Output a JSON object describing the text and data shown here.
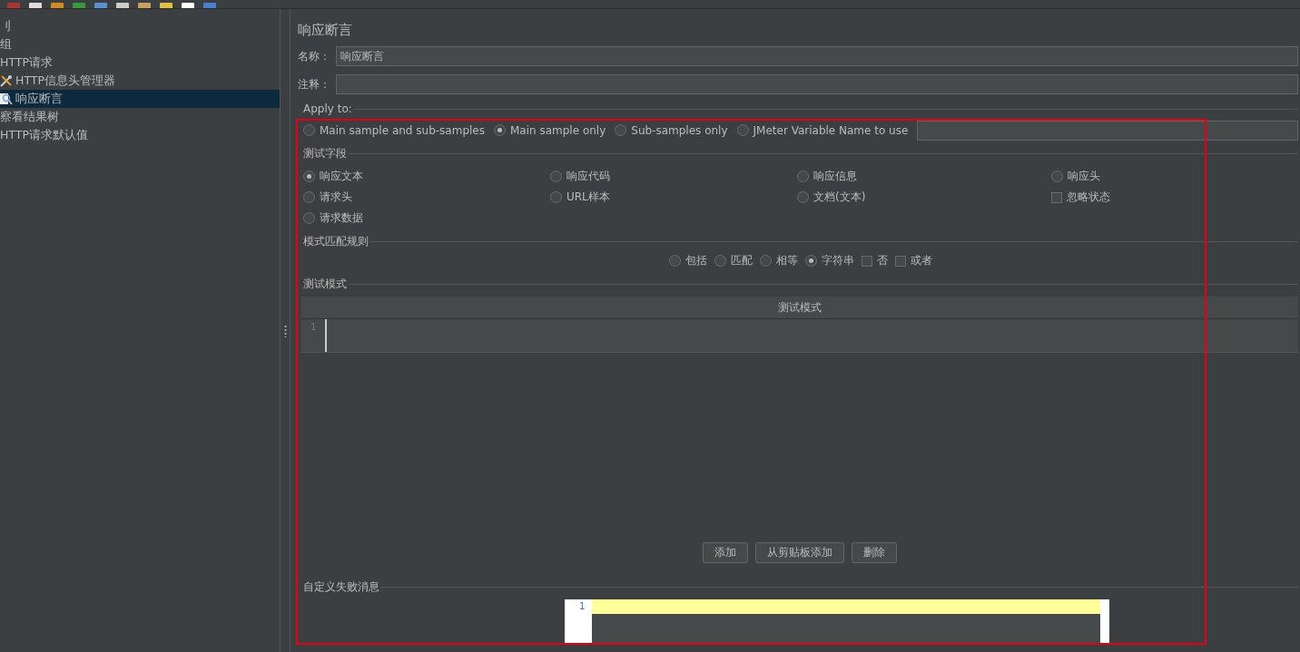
{
  "tree": [
    {
      "label": "刂",
      "selected": false,
      "children": [
        {
          "label": "组",
          "selected": false,
          "children": [
            {
              "label": "HTTP请求",
              "selected": false,
              "children": [
                {
                  "label": "HTTP信息头管理器",
                  "kind": "config",
                  "selected": false
                },
                {
                  "label": "响应断言",
                  "kind": "assertion",
                  "selected": true
                }
              ]
            },
            {
              "label": "察看结果树",
              "selected": false
            },
            {
              "label": "HTTP请求默认值",
              "selected": false
            }
          ]
        }
      ]
    }
  ],
  "panel_title": "响应断言",
  "name_field": {
    "label": "名称：",
    "value": "响应断言"
  },
  "comment_field": {
    "label": "注释："
  },
  "apply_to": {
    "title": "Apply to:",
    "options": [
      {
        "label": "Main sample and sub-samples",
        "selected": false
      },
      {
        "label": "Main sample only",
        "selected": true
      },
      {
        "label": "Sub-samples only",
        "selected": false
      },
      {
        "label": "JMeter Variable Name to use",
        "selected": false
      }
    ]
  },
  "test_field": {
    "title": "测试字段",
    "options": [
      {
        "label": "响应文本",
        "kind": "radio",
        "selected": true
      },
      {
        "label": "响应代码",
        "kind": "radio",
        "selected": false
      },
      {
        "label": "响应信息",
        "kind": "radio",
        "selected": false
      },
      {
        "label": "响应头",
        "kind": "radio",
        "selected": false
      },
      {
        "label": "请求头",
        "kind": "radio",
        "selected": false
      },
      {
        "label": "URL样本",
        "kind": "radio",
        "selected": false
      },
      {
        "label": "文档(文本)",
        "kind": "radio",
        "selected": false
      },
      {
        "label": "忽略状态",
        "kind": "checkbox",
        "checked": false
      },
      {
        "label": "请求数据",
        "kind": "radio",
        "selected": false
      }
    ]
  },
  "pattern_rules": {
    "title": "模式匹配规则",
    "options": [
      {
        "label": "包括",
        "kind": "radio",
        "selected": false
      },
      {
        "label": "匹配",
        "kind": "radio",
        "selected": false
      },
      {
        "label": "相等",
        "kind": "radio",
        "selected": false
      },
      {
        "label": "字符串",
        "kind": "radio",
        "selected": true
      },
      {
        "label": "否",
        "kind": "checkbox",
        "checked": false
      },
      {
        "label": "或者",
        "kind": "checkbox",
        "checked": false
      }
    ]
  },
  "test_patterns": {
    "title": "测试模式",
    "column": "测试模式",
    "line_number": "1",
    "buttons": [
      "添加",
      "从剪贴板添加",
      "删除"
    ]
  },
  "failure_message": {
    "title": "自定义失败消息",
    "line_number": "1"
  }
}
